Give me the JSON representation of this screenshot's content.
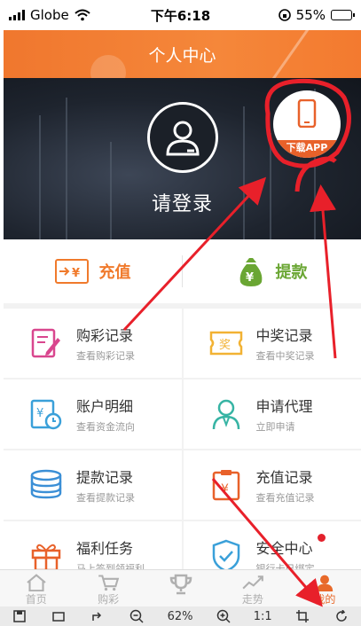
{
  "status_bar": {
    "carrier": "Globe",
    "time": "下午6:18",
    "battery": "55%",
    "battery_level": 0.55
  },
  "header": {
    "title": "个人中心"
  },
  "hero": {
    "login_label": "请登录",
    "download_badge": "下载APP"
  },
  "quick_actions": {
    "recharge": "充值",
    "withdraw": "提款"
  },
  "menu": [
    {
      "title": "购彩记录",
      "subtitle": "查看购彩记录",
      "icon": "edit-icon",
      "color": "#d9468e"
    },
    {
      "title": "中奖记录",
      "subtitle": "查看中奖记录",
      "icon": "prize-ticket-icon",
      "color": "#f2b233"
    },
    {
      "title": "账户明细",
      "subtitle": "查看资金流向",
      "icon": "account-statement-icon",
      "color": "#3aa0d9"
    },
    {
      "title": "申请代理",
      "subtitle": "立即申请",
      "icon": "agent-person-icon",
      "color": "#37b4a4"
    },
    {
      "title": "提款记录",
      "subtitle": "查看提款记录",
      "icon": "coins-icon",
      "color": "#3b8fd6"
    },
    {
      "title": "充值记录",
      "subtitle": "查看充值记录",
      "icon": "recharge-clipboard-icon",
      "color": "#e8612a"
    },
    {
      "title": "福利任务",
      "subtitle": "马上签到领福利",
      "icon": "gift-icon",
      "color": "#e8612a"
    },
    {
      "title": "安全中心",
      "subtitle": "银行卡已绑定",
      "icon": "shield-check-icon",
      "color": "#3aa0d9"
    }
  ],
  "tabbar": [
    {
      "label": "首页",
      "icon": "home-icon"
    },
    {
      "label": "购彩",
      "icon": "cart-icon"
    },
    {
      "label": "",
      "icon": "trophy-icon"
    },
    {
      "label": "走势",
      "icon": "trend-icon"
    },
    {
      "label": "我的",
      "icon": "user-icon"
    }
  ],
  "viewer_toolbar": {
    "zoom": "62%",
    "ratio": "1:1"
  },
  "colors": {
    "accent": "#f07a2c",
    "withdraw": "#6aa633",
    "annotation": "#e8202a"
  }
}
